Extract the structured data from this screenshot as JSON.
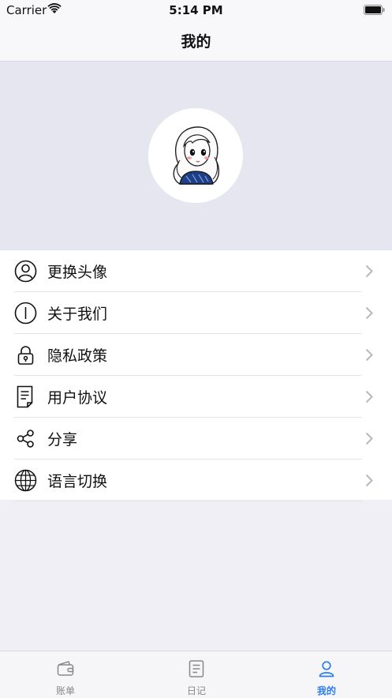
{
  "status_bar": {
    "carrier": "Carrier",
    "time": "5:14 PM"
  },
  "nav": {
    "title": "我的"
  },
  "profile": {
    "avatar": "user-avatar-illustration"
  },
  "menu": [
    {
      "label": "更换头像",
      "icon": "person-icon"
    },
    {
      "label": "关于我们",
      "icon": "info-icon"
    },
    {
      "label": "隐私政策",
      "icon": "lock-icon"
    },
    {
      "label": "用户协议",
      "icon": "document-icon"
    },
    {
      "label": "分享",
      "icon": "share-icon"
    },
    {
      "label": "语言切换",
      "icon": "globe-icon"
    }
  ],
  "tab_bar": {
    "tabs": [
      {
        "label": "账单",
        "icon": "wallet-icon",
        "active": false
      },
      {
        "label": "日记",
        "icon": "notes-icon",
        "active": false
      },
      {
        "label": "我的",
        "icon": "profile-icon",
        "active": true
      }
    ],
    "active_color": "#2b7cf0",
    "inactive_color": "#888888"
  }
}
